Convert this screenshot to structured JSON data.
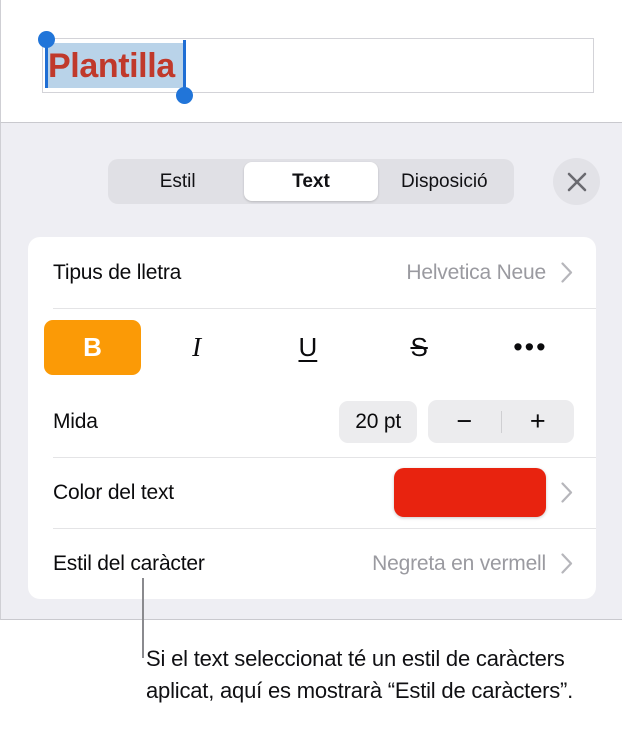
{
  "document": {
    "selected_text": "Plantilla",
    "text_color": "#c0392b",
    "selection_highlight_color": "#b9d3e9",
    "handle_color": "#2175d9"
  },
  "panel": {
    "tabs": [
      {
        "label": "Estil",
        "selected": false
      },
      {
        "label": "Text",
        "selected": true
      },
      {
        "label": "Disposició",
        "selected": false
      }
    ],
    "close_icon": "close-icon",
    "rows": {
      "font": {
        "label": "Tipus de lletra",
        "value": "Helvetica Neue",
        "chevron": "chevron-right-icon"
      },
      "format": {
        "bold": {
          "glyph": "B",
          "active": true,
          "active_color": "#fb9a06"
        },
        "italic": {
          "glyph": "I",
          "active": false
        },
        "underline": {
          "glyph": "U",
          "active": false
        },
        "strikethrough": {
          "glyph": "S",
          "active": false
        },
        "more": {
          "glyph": "•••",
          "active": false
        }
      },
      "size": {
        "label": "Mida",
        "value": "20 pt",
        "decrement": "−",
        "increment": "+"
      },
      "text_color": {
        "label": "Color del text",
        "swatch_color": "#e8230f",
        "chevron": "chevron-right-icon"
      },
      "character_style": {
        "label": "Estil del caràcter",
        "value": "Negreta en vermell",
        "chevron": "chevron-right-icon"
      }
    }
  },
  "callout": {
    "caption": "Si el text seleccionat té un estil de caràcters aplicat, aquí es mostrarà “Estil de caràcters”."
  }
}
